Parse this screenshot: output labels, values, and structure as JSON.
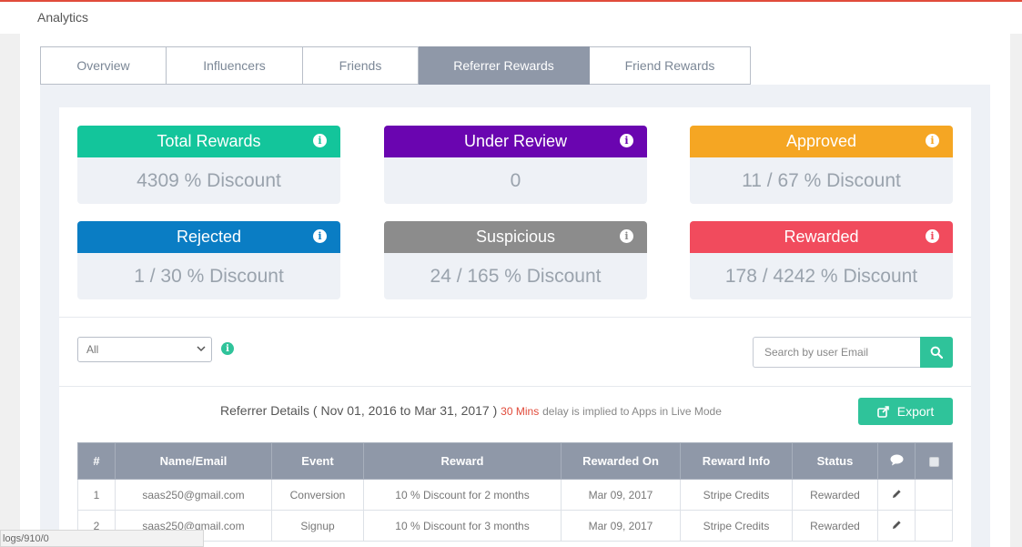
{
  "app": {
    "title": "Analytics"
  },
  "tabs": [
    {
      "label": "Overview",
      "active": false
    },
    {
      "label": "Influencers",
      "active": false
    },
    {
      "label": "Friends",
      "active": false
    },
    {
      "label": "Referrer Rewards",
      "active": true
    },
    {
      "label": "Friend Rewards",
      "active": false
    }
  ],
  "cards": [
    {
      "title": "Total Rewards",
      "value": "4309 % Discount",
      "color": "#13c59b"
    },
    {
      "title": "Under Review",
      "value": "0",
      "color": "#6a05b0"
    },
    {
      "title": "Approved",
      "value": "11 / 67 % Discount",
      "color": "#f5a623"
    },
    {
      "title": "Rejected",
      "value": "1 / 30 % Discount",
      "color": "#0a7dc4"
    },
    {
      "title": "Suspicious",
      "value": "24 / 165 % Discount",
      "color": "#8c8c8c"
    },
    {
      "title": "Rewarded",
      "value": "178 / 4242 % Discount",
      "color": "#f14b5d"
    }
  ],
  "filter": {
    "selected": "All"
  },
  "search": {
    "placeholder": "Search by user Email"
  },
  "details": {
    "label": "Referrer Details",
    "open_paren": "(",
    "range": "Nov 01, 2016 to Mar 31, 2017",
    "close_paren": ")",
    "delay": "30 Mins",
    "delay_note": "delay is implied to Apps in Live Mode"
  },
  "export": {
    "label": "Export"
  },
  "table": {
    "headers": [
      "#",
      "Name/Email",
      "Event",
      "Reward",
      "Rewarded On",
      "Reward Info",
      "Status"
    ],
    "rows": [
      [
        "1",
        "saas250@gmail.com",
        "Conversion",
        "10 % Discount for 2 months",
        "Mar 09, 2017",
        "Stripe Credits",
        "Rewarded"
      ],
      [
        "2",
        "saas250@gmail.com",
        "Signup",
        "10 % Discount for 3 months",
        "Mar 09, 2017",
        "Stripe Credits",
        "Rewarded"
      ]
    ]
  },
  "status_url": "logs/910/0",
  "colors": {
    "accent": "#2fc39a",
    "tab_active": "#8f98a8",
    "danger": "#e14b3b"
  }
}
